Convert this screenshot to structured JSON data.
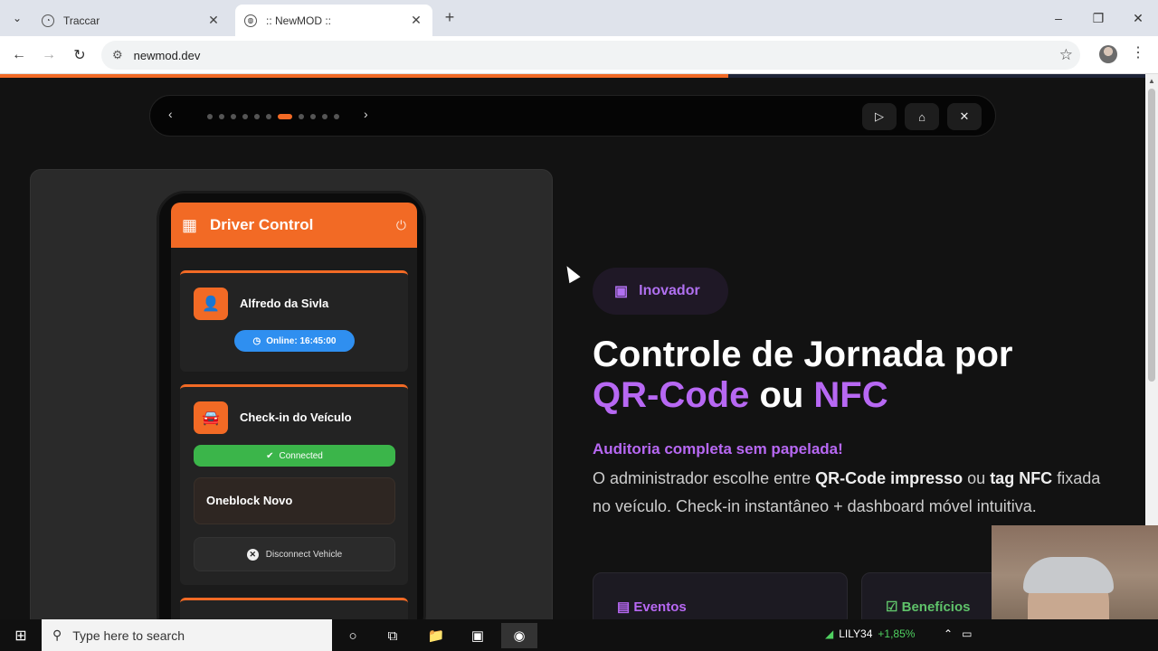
{
  "browser": {
    "tabs": [
      {
        "title": "Traccar",
        "active": false
      },
      {
        "title": ":: NewMOD ::",
        "active": true
      }
    ],
    "url": "newmod.dev",
    "new_tab": "+",
    "win_min": "–",
    "win_max": "❐",
    "win_close": "✕"
  },
  "page": {
    "progress_percent": 63.6,
    "slides": {
      "count": 11,
      "active_index": 6
    },
    "phone": {
      "app_title": "Driver Control",
      "driver_name": "Alfredo da Sivla",
      "online_label": "Online: 16:45:00",
      "checkin_title": "Check-in do Veículo",
      "connected_label": "Connected",
      "vehicle_name": "Oneblock Novo",
      "disconnect_label": "Disconnect Vehicle"
    },
    "badge": "Inovador",
    "headline": {
      "line1": "Controle de Jornada por",
      "accent1": "QR-Code",
      "mid": " ou ",
      "accent2": "NFC"
    },
    "subhead": "Auditoria completa sem papelada!",
    "desc": {
      "part1": "O administrador escolhe entre ",
      "b1": "QR-Code impresso",
      "part2": " ou ",
      "b2": "tag NFC",
      "part3": " fixada no veículo. Check-in instantâneo + dashboard móvel intuitiva."
    },
    "cards": {
      "eventos": "Eventos",
      "beneficios": "Benefícios"
    }
  },
  "taskbar": {
    "search_placeholder": "Type here to search",
    "stock_symbol": "LILY34",
    "stock_change": "+1,85%"
  },
  "colors": {
    "accent": "#f26a25",
    "purple": "#b768f3",
    "green": "#3bb54a",
    "blue": "#2f8ff0"
  }
}
